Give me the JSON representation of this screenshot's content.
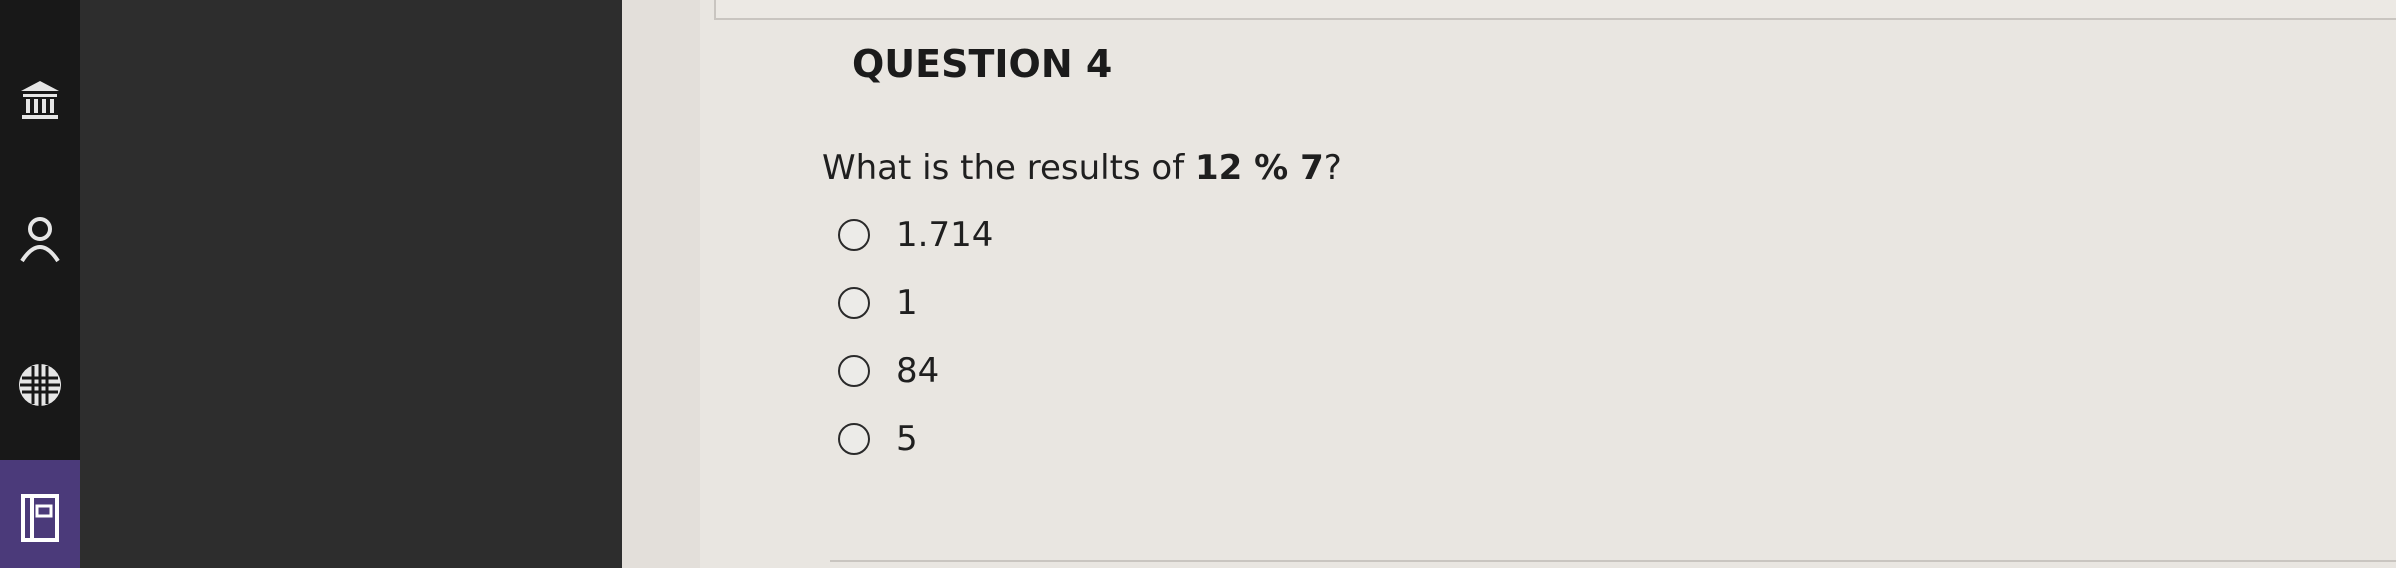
{
  "nav": {
    "icons": [
      "institution-icon",
      "profile-icon",
      "globe-icon",
      "courses-icon"
    ]
  },
  "question": {
    "heading": "QUESTION 4",
    "prompt_before": "What is the results of ",
    "expression": "12 % 7",
    "prompt_after": "?",
    "options": [
      {
        "label": "1.714"
      },
      {
        "label": "1"
      },
      {
        "label": "84"
      },
      {
        "label": "5"
      }
    ]
  }
}
